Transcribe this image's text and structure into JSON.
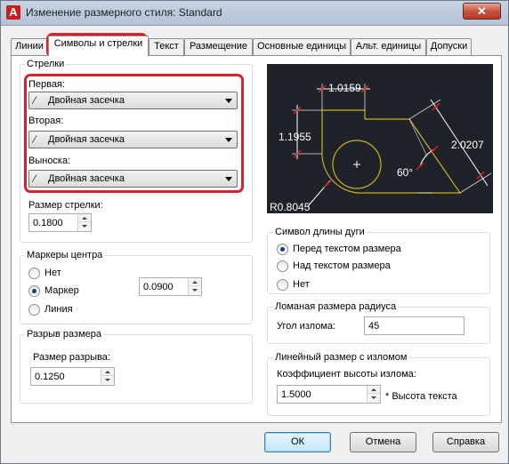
{
  "window": {
    "title": "Изменение размерного стиля: Standard",
    "close_glyph": "✕",
    "app_icon_letter": "A",
    "accent_color": "#d8232a"
  },
  "tabs": [
    {
      "label": "Линии"
    },
    {
      "label": "Символы и стрелки"
    },
    {
      "label": "Текст"
    },
    {
      "label": "Размещение"
    },
    {
      "label": "Основные единицы"
    },
    {
      "label": "Альт. единицы"
    },
    {
      "label": "Допуски"
    }
  ],
  "arrows": {
    "group_caption": "Стрелки",
    "first_label": "Первая:",
    "first_value": "Двойная засечка",
    "second_label": "Вторая:",
    "second_value": "Двойная засечка",
    "leader_label": "Выноска:",
    "leader_value": "Двойная засечка",
    "size_label": "Размер стрелки:",
    "size_value": "0.1800"
  },
  "center_marks": {
    "group_caption": "Маркеры центра",
    "options": [
      "Нет",
      "Маркер",
      "Линия"
    ],
    "selected": "Маркер",
    "size_value": "0.0900"
  },
  "dim_break": {
    "group_caption": "Разрыв размера",
    "size_label": "Размер разрыва:",
    "size_value": "0.1250"
  },
  "preview": {
    "labels": [
      "1.0159",
      "1.1955",
      "2.0207",
      "60°",
      "R0.8045"
    ]
  },
  "arc_length": {
    "group_caption": "Символ длины дуги",
    "options": [
      "Перед текстом размера",
      "Над текстом размера",
      "Нет"
    ],
    "selected": "Перед текстом размера"
  },
  "radius_jog": {
    "group_caption": "Ломаная размера радиуса",
    "angle_label": "Угол излома:",
    "angle_value": "45"
  },
  "linear_jog": {
    "group_caption": "Линейный размер с изломом",
    "factor_label": "Коэффициент высоты излома:",
    "factor_value": "1.5000",
    "factor_suffix": "* Высота текста"
  },
  "buttons": {
    "ok": "ОК",
    "cancel": "Отмена",
    "help": "Справка"
  }
}
